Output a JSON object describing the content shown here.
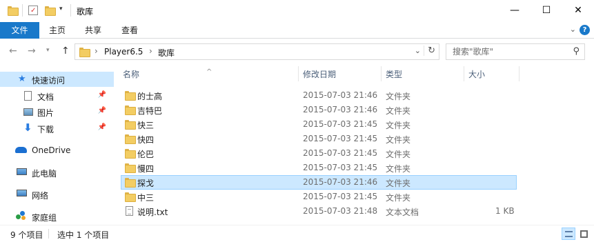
{
  "window": {
    "title": "歌库",
    "controls": {
      "minimize": "—",
      "maximize": "☐",
      "close": "✕"
    }
  },
  "ribbon": {
    "tabs": [
      "文件",
      "主页",
      "共享",
      "查看"
    ],
    "collapse_icon": "chevron-down-icon",
    "help_label": "?"
  },
  "address": {
    "crumbs": [
      "Player6.5",
      "歌库"
    ],
    "separator": "›"
  },
  "search": {
    "placeholder": "搜索\"歌库\""
  },
  "sidebar": {
    "quick_access": "快速访问",
    "items": [
      {
        "label": "文档",
        "icon": "document-icon",
        "pinned": true
      },
      {
        "label": "图片",
        "icon": "picture-icon",
        "pinned": true
      },
      {
        "label": "下载",
        "icon": "download-icon",
        "pinned": true
      }
    ],
    "onedrive": "OneDrive",
    "this_pc": "此电脑",
    "network": "网络",
    "homegroup": "家庭组"
  },
  "columns": {
    "name": "名称",
    "date": "修改日期",
    "type": "类型",
    "size": "大小"
  },
  "files": [
    {
      "name": "的士高",
      "date": "2015-07-03 21:46",
      "type": "文件夹",
      "size": "",
      "kind": "folder"
    },
    {
      "name": "吉特巴",
      "date": "2015-07-03 21:46",
      "type": "文件夹",
      "size": "",
      "kind": "folder"
    },
    {
      "name": "快三",
      "date": "2015-07-03 21:45",
      "type": "文件夹",
      "size": "",
      "kind": "folder"
    },
    {
      "name": "快四",
      "date": "2015-07-03 21:45",
      "type": "文件夹",
      "size": "",
      "kind": "folder"
    },
    {
      "name": "伦巴",
      "date": "2015-07-03 21:45",
      "type": "文件夹",
      "size": "",
      "kind": "folder"
    },
    {
      "name": "慢四",
      "date": "2015-07-03 21:45",
      "type": "文件夹",
      "size": "",
      "kind": "folder"
    },
    {
      "name": "探戈",
      "date": "2015-07-03 21:46",
      "type": "文件夹",
      "size": "",
      "kind": "folder",
      "selected": true
    },
    {
      "name": "中三",
      "date": "2015-07-03 21:45",
      "type": "文件夹",
      "size": "",
      "kind": "folder"
    },
    {
      "name": "说明.txt",
      "date": "2015-07-03 21:48",
      "type": "文本文档",
      "size": "1 KB",
      "kind": "text"
    }
  ],
  "status": {
    "item_count": "9 个项目",
    "selection": "选中 1 个项目"
  },
  "colors": {
    "accent": "#1979ca",
    "selection": "#cce8ff",
    "folder": "#f3cd63"
  }
}
